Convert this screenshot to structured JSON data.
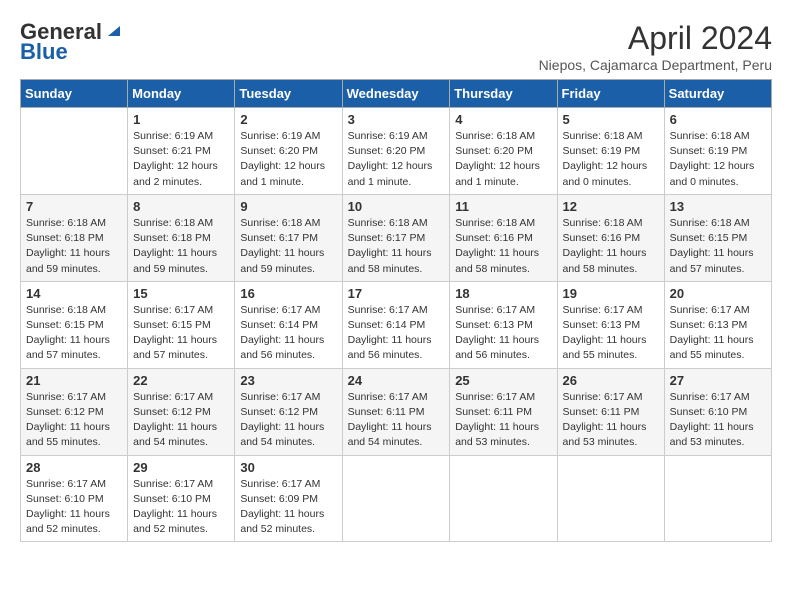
{
  "logo": {
    "general": "General",
    "blue": "Blue"
  },
  "header": {
    "month_title": "April 2024",
    "subtitle": "Niepos, Cajamarca Department, Peru"
  },
  "days_of_week": [
    "Sunday",
    "Monday",
    "Tuesday",
    "Wednesday",
    "Thursday",
    "Friday",
    "Saturday"
  ],
  "weeks": [
    [
      {
        "num": "",
        "info": ""
      },
      {
        "num": "1",
        "info": "Sunrise: 6:19 AM\nSunset: 6:21 PM\nDaylight: 12 hours\nand 2 minutes."
      },
      {
        "num": "2",
        "info": "Sunrise: 6:19 AM\nSunset: 6:20 PM\nDaylight: 12 hours\nand 1 minute."
      },
      {
        "num": "3",
        "info": "Sunrise: 6:19 AM\nSunset: 6:20 PM\nDaylight: 12 hours\nand 1 minute."
      },
      {
        "num": "4",
        "info": "Sunrise: 6:18 AM\nSunset: 6:20 PM\nDaylight: 12 hours\nand 1 minute."
      },
      {
        "num": "5",
        "info": "Sunrise: 6:18 AM\nSunset: 6:19 PM\nDaylight: 12 hours\nand 0 minutes."
      },
      {
        "num": "6",
        "info": "Sunrise: 6:18 AM\nSunset: 6:19 PM\nDaylight: 12 hours\nand 0 minutes."
      }
    ],
    [
      {
        "num": "7",
        "info": "Sunrise: 6:18 AM\nSunset: 6:18 PM\nDaylight: 11 hours\nand 59 minutes."
      },
      {
        "num": "8",
        "info": "Sunrise: 6:18 AM\nSunset: 6:18 PM\nDaylight: 11 hours\nand 59 minutes."
      },
      {
        "num": "9",
        "info": "Sunrise: 6:18 AM\nSunset: 6:17 PM\nDaylight: 11 hours\nand 59 minutes."
      },
      {
        "num": "10",
        "info": "Sunrise: 6:18 AM\nSunset: 6:17 PM\nDaylight: 11 hours\nand 58 minutes."
      },
      {
        "num": "11",
        "info": "Sunrise: 6:18 AM\nSunset: 6:16 PM\nDaylight: 11 hours\nand 58 minutes."
      },
      {
        "num": "12",
        "info": "Sunrise: 6:18 AM\nSunset: 6:16 PM\nDaylight: 11 hours\nand 58 minutes."
      },
      {
        "num": "13",
        "info": "Sunrise: 6:18 AM\nSunset: 6:15 PM\nDaylight: 11 hours\nand 57 minutes."
      }
    ],
    [
      {
        "num": "14",
        "info": "Sunrise: 6:18 AM\nSunset: 6:15 PM\nDaylight: 11 hours\nand 57 minutes."
      },
      {
        "num": "15",
        "info": "Sunrise: 6:17 AM\nSunset: 6:15 PM\nDaylight: 11 hours\nand 57 minutes."
      },
      {
        "num": "16",
        "info": "Sunrise: 6:17 AM\nSunset: 6:14 PM\nDaylight: 11 hours\nand 56 minutes."
      },
      {
        "num": "17",
        "info": "Sunrise: 6:17 AM\nSunset: 6:14 PM\nDaylight: 11 hours\nand 56 minutes."
      },
      {
        "num": "18",
        "info": "Sunrise: 6:17 AM\nSunset: 6:13 PM\nDaylight: 11 hours\nand 56 minutes."
      },
      {
        "num": "19",
        "info": "Sunrise: 6:17 AM\nSunset: 6:13 PM\nDaylight: 11 hours\nand 55 minutes."
      },
      {
        "num": "20",
        "info": "Sunrise: 6:17 AM\nSunset: 6:13 PM\nDaylight: 11 hours\nand 55 minutes."
      }
    ],
    [
      {
        "num": "21",
        "info": "Sunrise: 6:17 AM\nSunset: 6:12 PM\nDaylight: 11 hours\nand 55 minutes."
      },
      {
        "num": "22",
        "info": "Sunrise: 6:17 AM\nSunset: 6:12 PM\nDaylight: 11 hours\nand 54 minutes."
      },
      {
        "num": "23",
        "info": "Sunrise: 6:17 AM\nSunset: 6:12 PM\nDaylight: 11 hours\nand 54 minutes."
      },
      {
        "num": "24",
        "info": "Sunrise: 6:17 AM\nSunset: 6:11 PM\nDaylight: 11 hours\nand 54 minutes."
      },
      {
        "num": "25",
        "info": "Sunrise: 6:17 AM\nSunset: 6:11 PM\nDaylight: 11 hours\nand 53 minutes."
      },
      {
        "num": "26",
        "info": "Sunrise: 6:17 AM\nSunset: 6:11 PM\nDaylight: 11 hours\nand 53 minutes."
      },
      {
        "num": "27",
        "info": "Sunrise: 6:17 AM\nSunset: 6:10 PM\nDaylight: 11 hours\nand 53 minutes."
      }
    ],
    [
      {
        "num": "28",
        "info": "Sunrise: 6:17 AM\nSunset: 6:10 PM\nDaylight: 11 hours\nand 52 minutes."
      },
      {
        "num": "29",
        "info": "Sunrise: 6:17 AM\nSunset: 6:10 PM\nDaylight: 11 hours\nand 52 minutes."
      },
      {
        "num": "30",
        "info": "Sunrise: 6:17 AM\nSunset: 6:09 PM\nDaylight: 11 hours\nand 52 minutes."
      },
      {
        "num": "",
        "info": ""
      },
      {
        "num": "",
        "info": ""
      },
      {
        "num": "",
        "info": ""
      },
      {
        "num": "",
        "info": ""
      }
    ]
  ]
}
